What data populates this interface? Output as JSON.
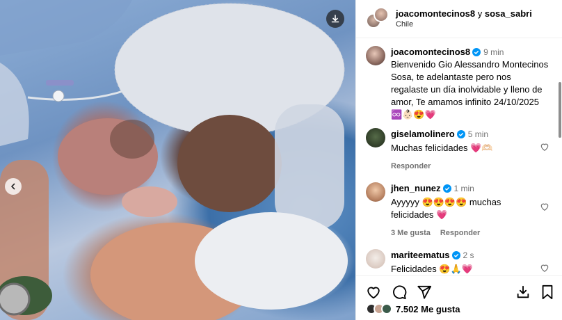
{
  "header": {
    "user1": "joacomontecinos8",
    "connector": "y",
    "user2": "sosa_sabri",
    "location": "Chile"
  },
  "caption": {
    "username": "joacomontecinos8",
    "time": "9 min",
    "text": "Bienvenido Gio Alessandro Montecinos Sosa, te adelantaste  pero nos regalaste un día inolvidable y lleno de amor, Te amamos infinito 24/10/2025 ♾️👶🏻😍💗"
  },
  "comments": [
    {
      "username": "giselamolinero",
      "time": "5 min",
      "text": "Muchas felicidades 💗🫶🏻",
      "reply": "Responder",
      "likes": ""
    },
    {
      "username": "jhen_nunez",
      "time": "1 min",
      "text": "Ayyyyy 😍😍😍😍 muchas felicidades 💗",
      "reply": "Responder",
      "likes": "3 Me gusta"
    },
    {
      "username": "mariteematus",
      "time": "2 s",
      "text": "Felicidades 😍🙏💗"
    }
  ],
  "footer": {
    "likes": "7.502 Me gusta"
  },
  "icons": {
    "download": "download-icon",
    "prev": "chevron-left-icon",
    "like": "heart-icon",
    "comment": "comment-icon",
    "share": "send-icon",
    "save_download": "download-icon",
    "bookmark": "bookmark-icon"
  },
  "colors": {
    "verified": "#0095f6",
    "muted": "#737373",
    "border": "#efefef"
  }
}
